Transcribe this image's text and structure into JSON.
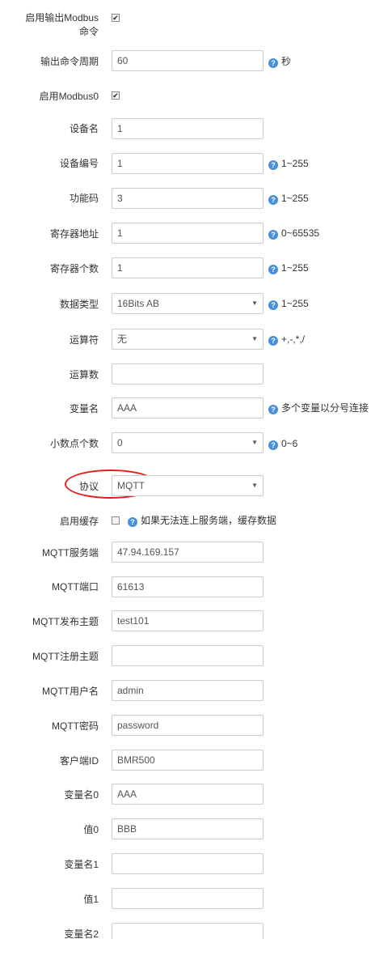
{
  "rows": {
    "enable_output_cmd": {
      "label_line1": "启用输出Modbus",
      "label_line2": "命令",
      "checked": "✔"
    },
    "output_period": {
      "label": "输出命令周期",
      "value": "60",
      "hint": "秒"
    },
    "enable_modbus0": {
      "label": "启用Modbus0",
      "checked": "✔"
    },
    "device_name": {
      "label": "设备名",
      "value": "1"
    },
    "device_id": {
      "label": "设备编号",
      "value": "1",
      "hint": "1~255"
    },
    "function_code": {
      "label": "功能码",
      "value": "3",
      "hint": "1~255"
    },
    "register_address": {
      "label": "寄存器地址",
      "value": "1",
      "hint": "0~65535"
    },
    "register_count": {
      "label": "寄存器个数",
      "value": "1",
      "hint": "1~255"
    },
    "data_type": {
      "label": "数据类型",
      "value": "16Bits AB",
      "hint": "1~255"
    },
    "operator": {
      "label": "运算符",
      "value": "无",
      "hint": "+,-,*,/"
    },
    "operand": {
      "label": "运算数",
      "value": ""
    },
    "variable_name": {
      "label": "变量名",
      "value": "AAA",
      "hint": "多个变量以分号连接"
    },
    "decimals": {
      "label": "小数点个数",
      "value": "0",
      "hint": "0~6"
    },
    "protocol": {
      "label": "协议",
      "value": "MQTT"
    },
    "enable_cache": {
      "label": "启用缓存",
      "hint": "如果无法连上服务端，缓存数据"
    },
    "mqtt_server": {
      "label": "MQTT服务端",
      "value": "47.94.169.157"
    },
    "mqtt_port": {
      "label": "MQTT端口",
      "value": "61613"
    },
    "mqtt_pub_topic": {
      "label": "MQTT发布主题",
      "value": "test101"
    },
    "mqtt_reg_topic": {
      "label": "MQTT注册主题",
      "value": ""
    },
    "mqtt_user": {
      "label": "MQTT用户名",
      "value": "admin"
    },
    "mqtt_password": {
      "label": "MQTT密码",
      "value": "password"
    },
    "client_id": {
      "label": "客户端ID",
      "value": "BMR500"
    },
    "var_name0": {
      "label": "变量名0",
      "value": "AAA"
    },
    "value0": {
      "label": "值0",
      "value": "BBB"
    },
    "var_name1": {
      "label": "变量名1",
      "value": ""
    },
    "value1": {
      "label": "值1",
      "value": ""
    },
    "var_name2": {
      "label": "变量名2",
      "value": ""
    }
  },
  "icons": {
    "help": "question-circle-icon",
    "dropdown": "caret-down-icon",
    "check": "checkmark-icon"
  },
  "colors": {
    "help_icon": "#4a90d9",
    "highlight_ellipse": "#e02020",
    "input_border": "#cccccc"
  }
}
